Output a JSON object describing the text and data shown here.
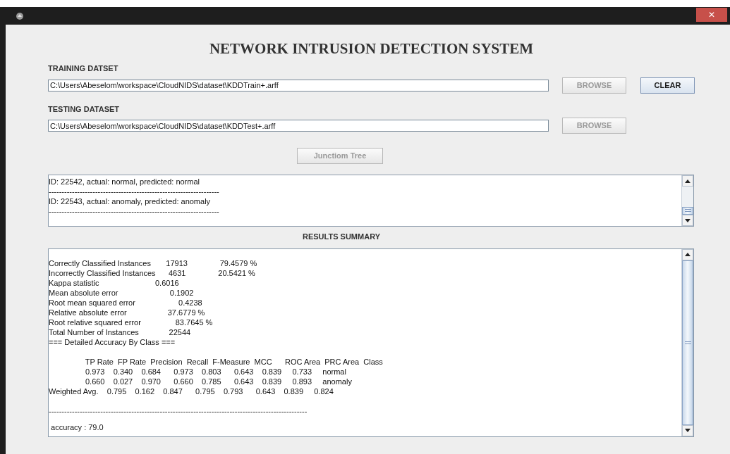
{
  "window": {
    "close_label": "✕"
  },
  "title": "NETWORK INTRUSION DETECTION SYSTEM",
  "training": {
    "label": "TRAINING DATSET",
    "value": "C:\\Users\\Abeselom\\workspace\\CloudNIDS\\dataset\\KDDTrain+.arff",
    "browse": {
      "label": "BROWSE",
      "disabled": true
    },
    "clear": {
      "label": "CLEAR",
      "disabled": false
    }
  },
  "testing": {
    "label": "TESTING DATASET",
    "value": "C:\\Users\\Abeselom\\workspace\\CloudNIDS\\dataset\\KDDTest+.arff",
    "browse": {
      "label": "BROWSE",
      "disabled": true
    }
  },
  "junction_button": {
    "label": "Junctiom Tree",
    "disabled": true
  },
  "log": {
    "lines": [
      "ID: 22542, actual: normal, predicted: normal",
      "------------------------------------------------------------------",
      "ID: 22543, actual: anomaly, predicted: anomaly",
      "------------------------------------------------------------------"
    ]
  },
  "results": {
    "heading": "RESULTS SUMMARY",
    "blocks": [
      [
        "Correctly Classified Instances       17913               79.4579 %",
        "Incorrectly Classified Instances      4631               20.5421 %",
        "Kappa statistic                          0.6016",
        "Mean absolute error                        0.1902",
        "Root mean squared error                    0.4238",
        "Relative absolute error                   37.6779 %",
        "Root relative squared error                83.7645 %",
        "Total Number of Instances              22544",
        "=== Detailed Accuracy By Class ==="
      ],
      [
        "                 TP Rate  FP Rate  Precision  Recall  F-Measure  MCC      ROC Area  PRC Area  Class",
        "                 0.973    0.340    0.684      0.973    0.803      0.643    0.839     0.733     normal",
        "                 0.660    0.027    0.970      0.660    0.785      0.643    0.839     0.893     anomaly",
        "Weighted Avg.    0.795    0.162    0.847      0.795    0.793      0.643    0.839     0.824"
      ],
      [
        "----------------------------------------------------------------------------------------------------"
      ],
      [
        " accuracy : 79.0"
      ]
    ]
  }
}
